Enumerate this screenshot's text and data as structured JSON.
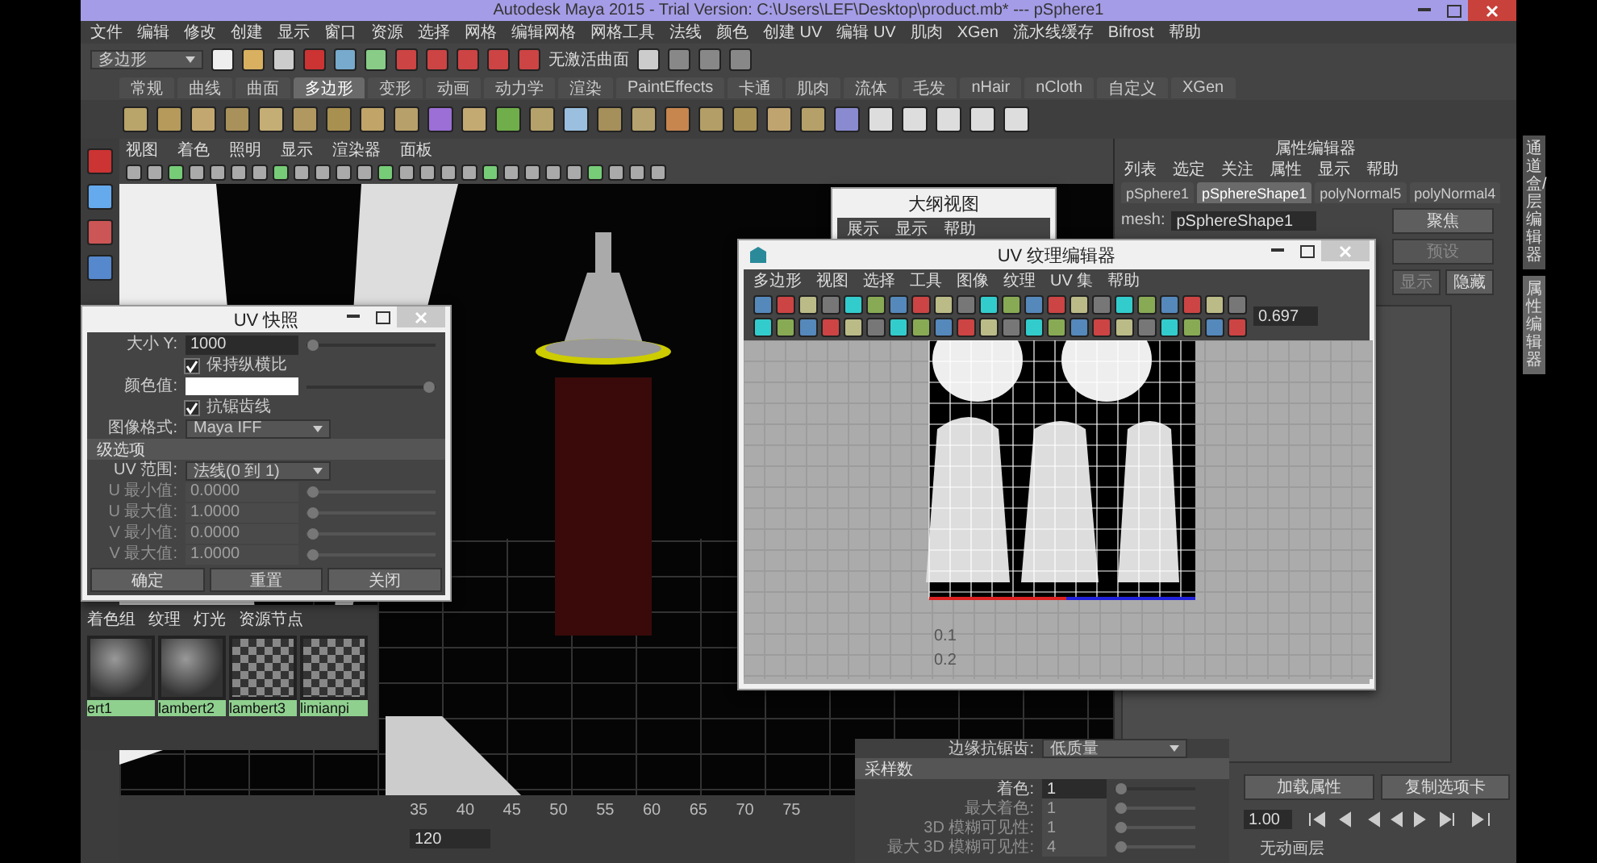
{
  "window": {
    "title": "Autodesk Maya 2015 - Trial Version: C:\\Users\\LEF\\Desktop\\product.mb*  ---  pSphere1"
  },
  "menu_bar": [
    "文件",
    "编辑",
    "修改",
    "创建",
    "显示",
    "窗口",
    "资源",
    "选择",
    "网格",
    "编辑网格",
    "网格工具",
    "法线",
    "颜色",
    "创建 UV",
    "编辑 UV",
    "肌肉",
    "XGen",
    "流水线缓存",
    "Bifrost",
    "帮助"
  ],
  "mode_dropdown": {
    "value": "多边形"
  },
  "live_surface": "无激活曲面",
  "shelf_tabs": [
    {
      "label": "常规",
      "selected": false
    },
    {
      "label": "曲线",
      "selected": false
    },
    {
      "label": "曲面",
      "selected": false
    },
    {
      "label": "多边形",
      "selected": true
    },
    {
      "label": "变形",
      "selected": false
    },
    {
      "label": "动画",
      "selected": false
    },
    {
      "label": "动力学",
      "selected": false
    },
    {
      "label": "渲染",
      "selected": false
    },
    {
      "label": "PaintEffects",
      "selected": false
    },
    {
      "label": "卡通",
      "selected": false
    },
    {
      "label": "肌肉",
      "selected": false
    },
    {
      "label": "流体",
      "selected": false
    },
    {
      "label": "毛发",
      "selected": false
    },
    {
      "label": "nHair",
      "selected": false
    },
    {
      "label": "nCloth",
      "selected": false
    },
    {
      "label": "自定义",
      "selected": false
    },
    {
      "label": "XGen",
      "selected": false
    }
  ],
  "viewport": {
    "menu": [
      "视图",
      "着色",
      "照明",
      "显示",
      "渲染器",
      "面板"
    ]
  },
  "attribute_editor": {
    "title": "属性编辑器",
    "menu": [
      "列表",
      "选定",
      "关注",
      "属性",
      "显示",
      "帮助"
    ],
    "tabs": [
      {
        "label": "pSphere1",
        "selected": false
      },
      {
        "label": "pSphereShape1",
        "selected": true
      },
      {
        "label": "polyNormal5",
        "selected": false
      },
      {
        "label": "polyNormal4",
        "selected": false
      }
    ],
    "mesh_label": "mesh:",
    "mesh_value": "pSphereShape1",
    "buttons": [
      {
        "label": "聚焦",
        "disabled": false
      },
      {
        "label": "预设",
        "disabled": true
      },
      {
        "label": "显示",
        "disabled": true
      },
      {
        "label": "隐藏",
        "disabled": false
      }
    ],
    "bottom_buttons": [
      "加载属性",
      "复制选项卡"
    ]
  },
  "side_tabs": [
    {
      "label": "通道盒/层编辑器",
      "selected": false
    },
    {
      "label": "属性编辑器",
      "selected": true
    }
  ],
  "timeline": {
    "ticks": [
      "35",
      "40",
      "45",
      "50",
      "55",
      "60",
      "65",
      "70",
      "75"
    ],
    "end_field": "120",
    "current": "1.00",
    "anim_layer": "无动画层"
  },
  "uv_snapshot": {
    "title": "UV 快照",
    "rows": [
      {
        "kind": "field",
        "label": "大小 Y:",
        "value": "1000",
        "disabled": false
      },
      {
        "kind": "check",
        "label": "保持纵横比",
        "checked": true
      },
      {
        "kind": "color",
        "label": "颜色值:"
      },
      {
        "kind": "check",
        "label": "抗锯齿线",
        "checked": true
      },
      {
        "kind": "dropdown",
        "label": "图像格式:",
        "value": "Maya IFF"
      },
      {
        "kind": "section",
        "label": "级选项"
      },
      {
        "kind": "dropdown",
        "label": "UV 范围:",
        "value": "法线(0 到 1)"
      },
      {
        "kind": "field",
        "label": "U 最小值:",
        "value": "0.0000",
        "disabled": true
      },
      {
        "kind": "field",
        "label": "U 最大值:",
        "value": "1.0000",
        "disabled": true
      },
      {
        "kind": "field",
        "label": "V 最小值:",
        "value": "0.0000",
        "disabled": true
      },
      {
        "kind": "field",
        "label": "V 最大值:",
        "value": "1.0000",
        "disabled": true
      }
    ],
    "buttons": [
      "确定",
      "重置",
      "关闭"
    ]
  },
  "outliner": {
    "title": "大纲视图",
    "menu": [
      "展示",
      "显示",
      "帮助"
    ]
  },
  "uv_editor": {
    "title": "UV 纹理编辑器",
    "menu": [
      "多边形",
      "视图",
      "选择",
      "工具",
      "图像",
      "纹理",
      "UV 集",
      "帮助"
    ],
    "value": "0.697",
    "axis_labels": [
      "0.1",
      "0.2"
    ]
  },
  "render_settings": {
    "rows": [
      {
        "kind": "dropdown",
        "label": "边缘抗锯齿:",
        "value": "低质量"
      },
      {
        "kind": "section",
        "label": "采样数"
      },
      {
        "kind": "field",
        "label": "着色:",
        "value": "1",
        "disabled": false
      },
      {
        "kind": "field",
        "label": "最大着色:",
        "value": "1",
        "disabled": true
      },
      {
        "kind": "field",
        "label": "3D 模糊可见性:",
        "value": "1",
        "disabled": true
      },
      {
        "kind": "field",
        "label": "最大 3D 模糊可见性:",
        "value": "4",
        "disabled": true
      }
    ]
  },
  "hypershade": {
    "tabs": [
      "着色组",
      "纹理",
      "灯光",
      "资源节点"
    ],
    "swatches": [
      {
        "label": "ert1",
        "kind": "sphere"
      },
      {
        "label": "lambert2",
        "kind": "sphere"
      },
      {
        "label": "lambert3",
        "kind": "checker"
      },
      {
        "label": "limianpi",
        "kind": "checker"
      }
    ]
  }
}
